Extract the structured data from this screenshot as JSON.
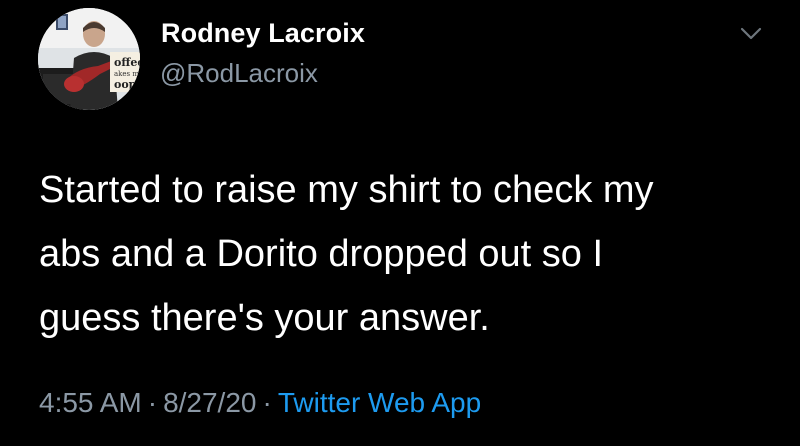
{
  "tweet": {
    "author": {
      "display_name": "Rodney Lacroix",
      "handle": "@RodLacroix",
      "avatar_icon": "profile-photo"
    },
    "text_lines": [
      "Started to raise my shirt to check my",
      "abs and a Dorito dropped out so I",
      "guess there's your answer."
    ],
    "time": "4:55 AM",
    "date": "8/27/20",
    "separator": "·",
    "source": "Twitter Web App",
    "menu_icon": "chevron-down-icon"
  },
  "colors": {
    "background": "#000000",
    "primary_text": "#ffffff",
    "secondary_text": "#8b98a5",
    "link": "#1d9bf0"
  }
}
